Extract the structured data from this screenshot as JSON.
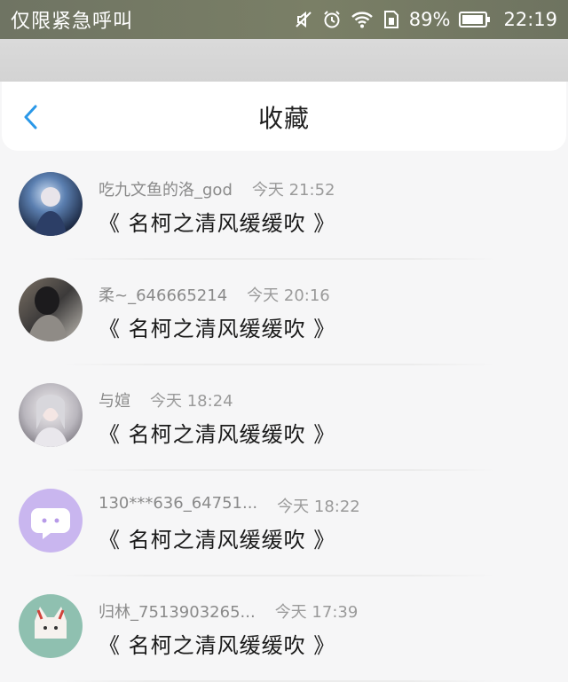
{
  "status_bar": {
    "carrier": "仅限紧急呼叫",
    "battery": "89%",
    "time": "22:19",
    "icons": [
      "mute-icon",
      "alarm-icon",
      "wifi-icon",
      "sim-icon",
      "battery-icon"
    ]
  },
  "header": {
    "title": "收藏",
    "back_icon": "chevron-left-icon",
    "accent": "#2a98e8"
  },
  "items": [
    {
      "name": "吃九文鱼的洛_god",
      "time": "今天 21:52",
      "title": "《 名柯之清风缓缓吹 》"
    },
    {
      "name": "柔~_646665214",
      "time": "今天 20:16",
      "title": "《 名柯之清风缓缓吹 》"
    },
    {
      "name": "与媗",
      "time": "今天 18:24",
      "title": "《 名柯之清风缓缓吹 》"
    },
    {
      "name": "130***636_64751...",
      "time": "今天 18:22",
      "title": "《 名柯之清风缓缓吹 》"
    },
    {
      "name": "归林_7513903265...",
      "time": "今天 17:39",
      "title": "《 名柯之清风缓缓吹 》"
    }
  ]
}
